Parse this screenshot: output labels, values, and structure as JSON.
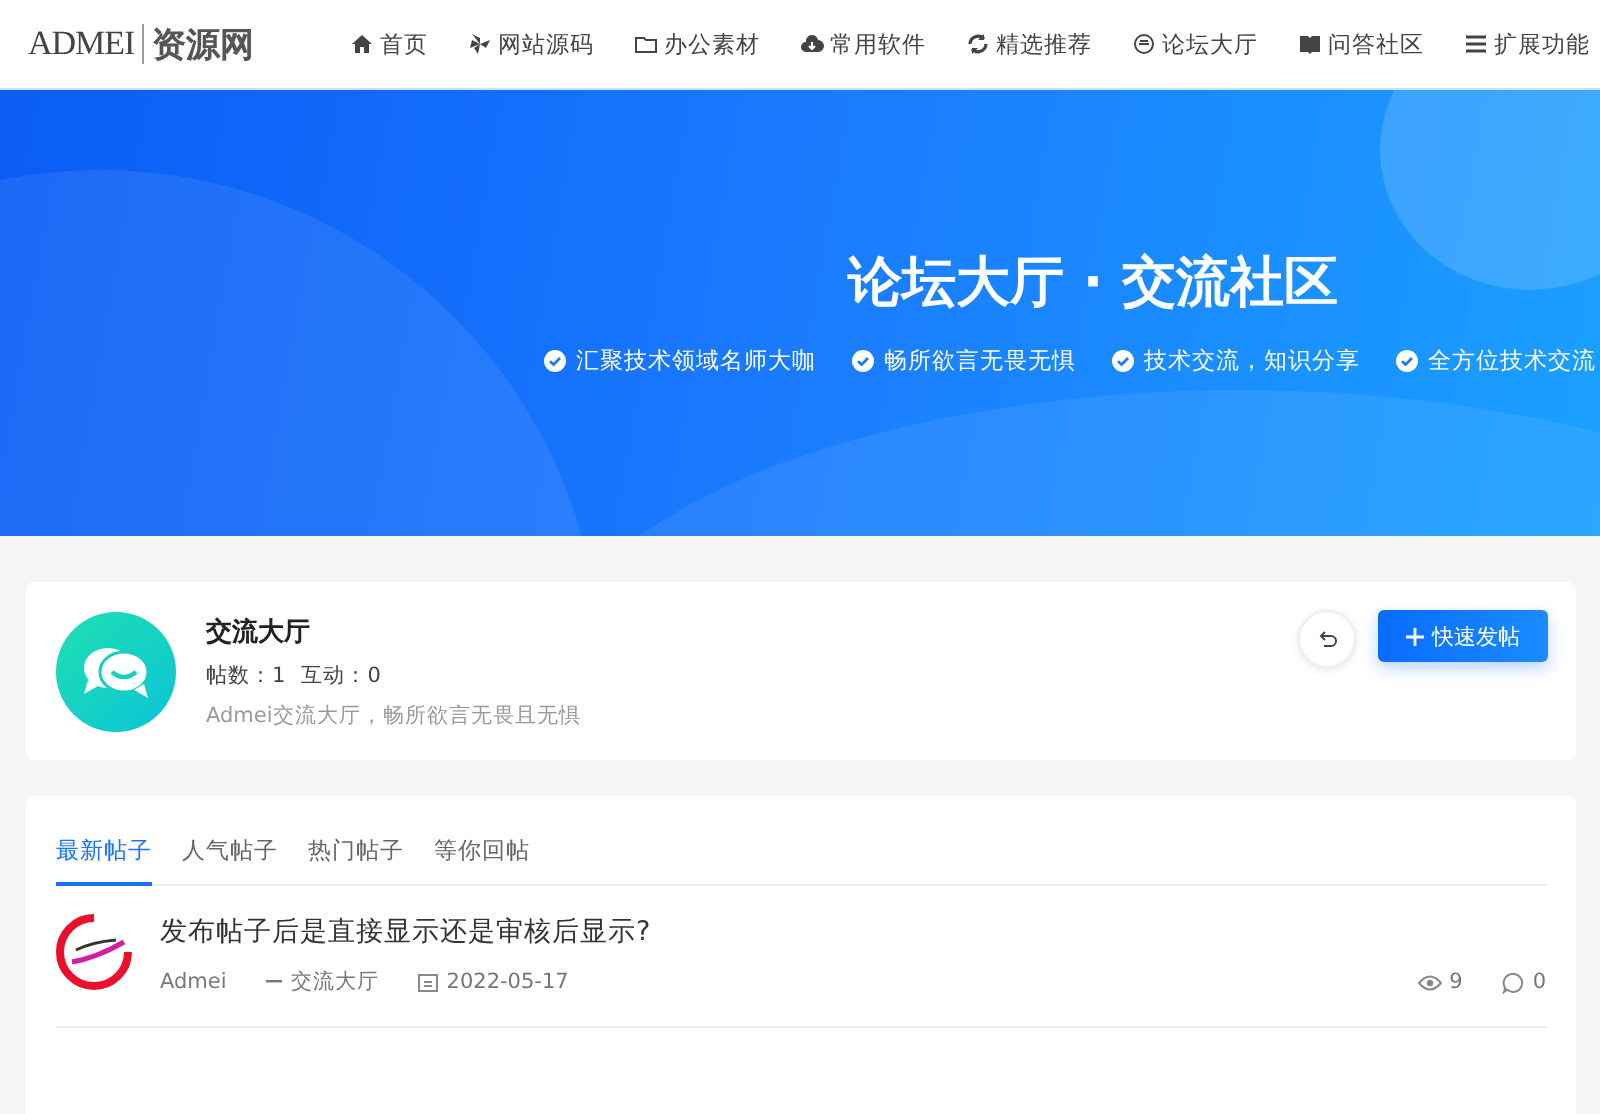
{
  "header": {
    "logo": {
      "latin": "ADMEI",
      "chinese": "资源网"
    },
    "nav": [
      "首页",
      "网站源码",
      "办公素材",
      "常用软件",
      "精选推荐",
      "论坛大厅",
      "问答社区",
      "扩展功能"
    ]
  },
  "banner": {
    "title": "论坛大厅 · 交流社区",
    "features": [
      "汇聚技术领域名师大咖",
      "畅所欲言无畏无惧",
      "技术交流，知识分享",
      "全方位技术交流"
    ]
  },
  "forum": {
    "name": "交流大厅",
    "stats": [
      {
        "label": "帖数：",
        "value": "1"
      },
      {
        "label": "互动：",
        "value": "0"
      }
    ],
    "description": "Admei交流大厅，畅所欲言无畏且无惧",
    "post_button": "快速发帖"
  },
  "tabs": [
    {
      "label": "最新帖子",
      "selected": true
    },
    {
      "label": "人气帖子",
      "selected": false
    },
    {
      "label": "热门帖子",
      "selected": false
    },
    {
      "label": "等你回帖",
      "selected": false
    }
  ],
  "posts": [
    {
      "title": "发布帖子后是直接显示还是审核后显示?",
      "author": "Admei",
      "board": "交流大厅",
      "date": "2022-05-17",
      "views": "9",
      "comments": "0"
    }
  ]
}
